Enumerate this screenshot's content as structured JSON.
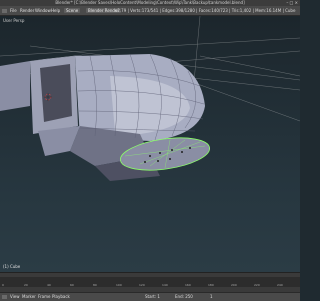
{
  "window": {
    "title": "Blender* [C:\\Blender Saves\\HoloContent\\Modeling\\Context\\Wip\\Tank\\Backup\\tankmodel.blend]",
    "controls": "–  □  ×"
  },
  "header": {
    "menu": [
      "File",
      "Render",
      "Window",
      "Help"
    ],
    "layout": "Scene",
    "scene": "Scene",
    "engine": "Blender Render",
    "stats": "v2.79 | Verts:173/541 | Edges:398/1280 | Faces:140/723 | Tris:1,402 | Mem:16.14M | Cube"
  },
  "viewport": {
    "view_label": "User Persp",
    "object_label": "(1) Cube"
  },
  "timeline": {
    "ticks": [
      "0",
      "20",
      "40",
      "60",
      "80",
      "100",
      "120",
      "140",
      "160",
      "180",
      "200",
      "220",
      "240"
    ]
  },
  "footer": {
    "view": "View",
    "marker": "Marker",
    "frame": "Frame",
    "playback": "Playback",
    "start": "Start: 1",
    "end": "End: 250",
    "current": "1"
  },
  "colors": {
    "mesh": "#a8adc2",
    "mesh_dark": "#5d6075",
    "selected_edge": "#8cff6a",
    "background": "#1f2a30"
  }
}
